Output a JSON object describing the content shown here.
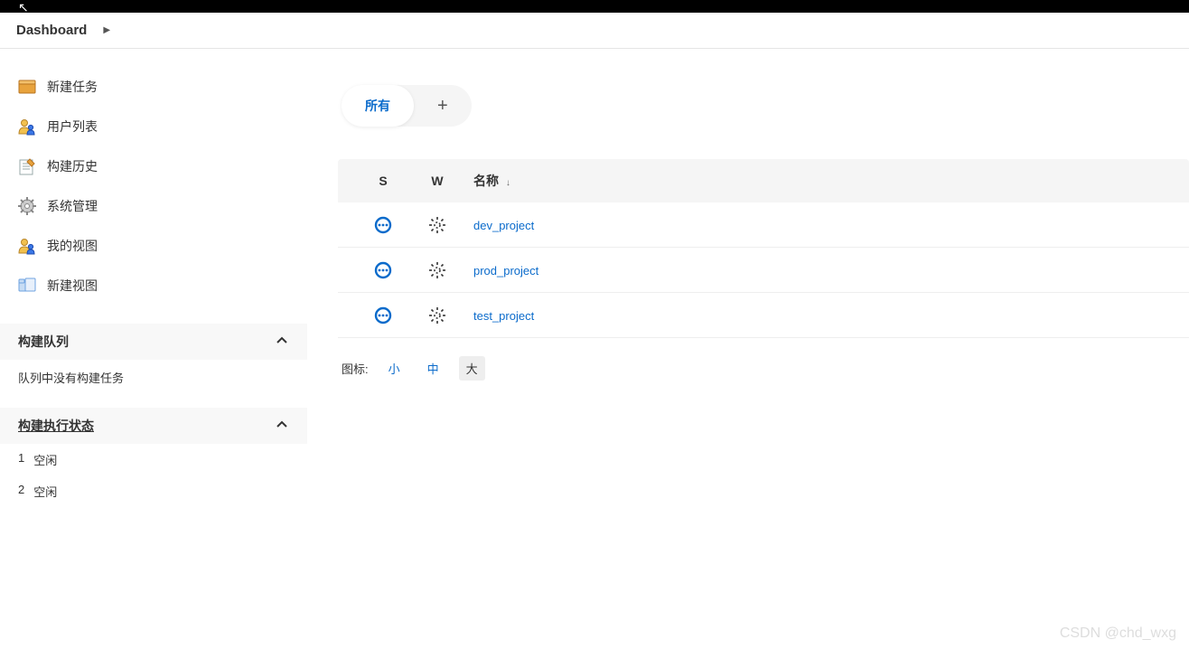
{
  "breadcrumb": {
    "title": "Dashboard"
  },
  "sidebar": {
    "links": [
      {
        "label": "新建任务",
        "icon": "new-item-icon"
      },
      {
        "label": "用户列表",
        "icon": "people-icon"
      },
      {
        "label": "构建历史",
        "icon": "history-icon"
      },
      {
        "label": "系统管理",
        "icon": "gear-icon"
      },
      {
        "label": "我的视图",
        "icon": "my-views-icon"
      },
      {
        "label": "新建视图",
        "icon": "new-view-icon"
      }
    ],
    "queue_title": "构建队列",
    "queue_empty": "队列中没有构建任务",
    "executor_title": "构建执行状态",
    "executors": [
      {
        "num": "1",
        "state": "空闲"
      },
      {
        "num": "2",
        "state": "空闲"
      }
    ]
  },
  "tabs": {
    "all": "所有"
  },
  "table": {
    "head": {
      "s": "S",
      "w": "W",
      "name": "名称"
    },
    "rows": [
      {
        "name": "dev_project"
      },
      {
        "name": "prod_project"
      },
      {
        "name": "test_project"
      }
    ]
  },
  "icon_size": {
    "label": "图标:",
    "small": "小",
    "medium": "中",
    "large": "大"
  },
  "watermark": "CSDN @chd_wxg"
}
